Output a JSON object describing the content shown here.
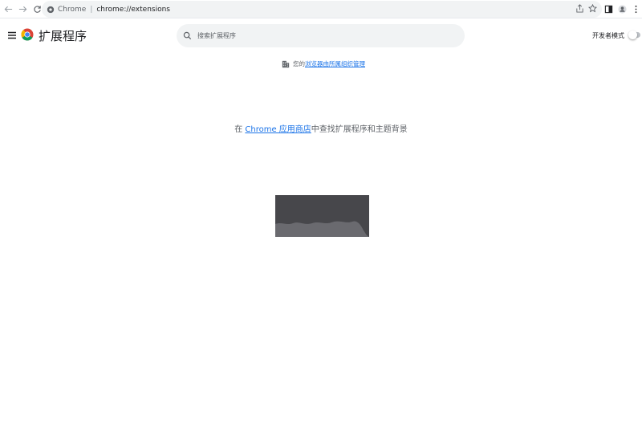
{
  "browser": {
    "site_name": "Chrome",
    "separator": "|",
    "url_prefix": "chrome://",
    "url_path": "extensions"
  },
  "header": {
    "title": "扩展程序",
    "search_placeholder": "搜索扩展程序",
    "dev_mode_label": "开发者模式",
    "dev_mode_enabled": false
  },
  "managed_notice": {
    "prefix": "您的",
    "link": "浏览器由所属组织管理"
  },
  "store_prompt": {
    "prefix": "在 ",
    "link": "Chrome 应用商店",
    "suffix": "中查找扩展程序和主题背景"
  },
  "colors": {
    "accent": "#1a73e8",
    "omnibox_bg": "#f1f3f4",
    "text_secondary": "#5f6368"
  }
}
